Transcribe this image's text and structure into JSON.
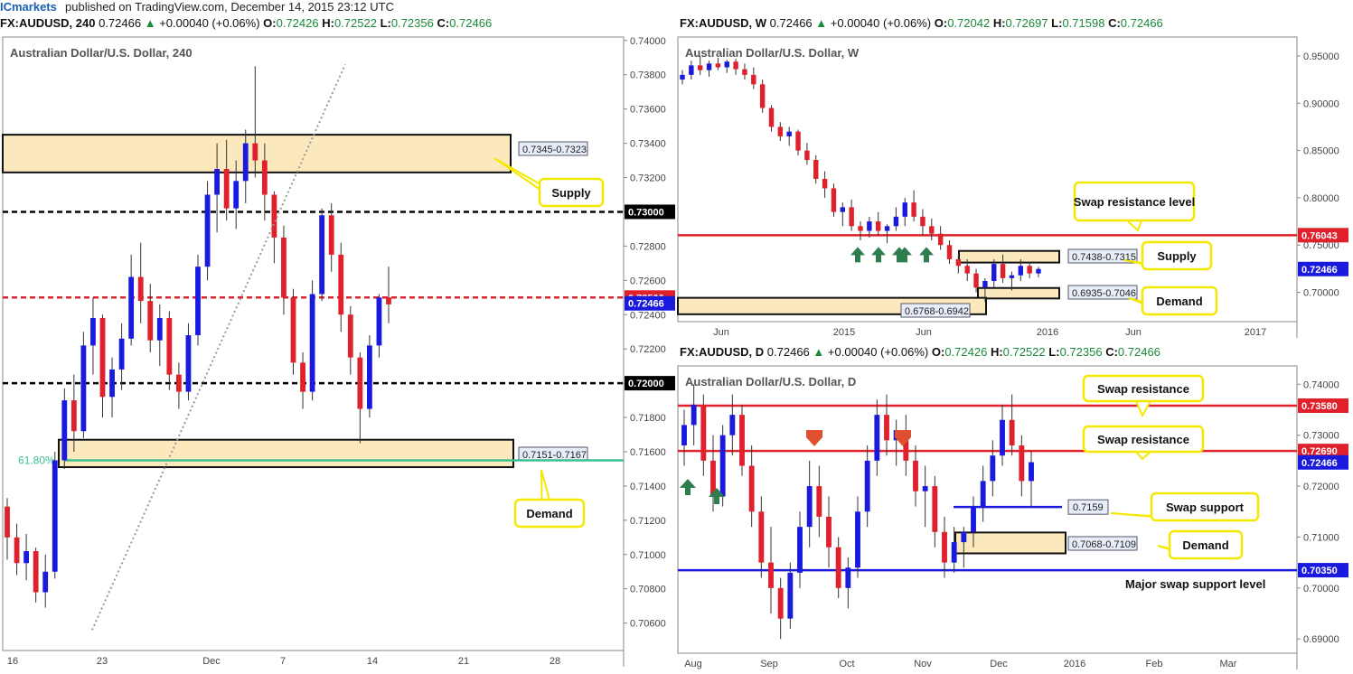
{
  "publisher": {
    "brand": "ICmarkets",
    "text": "published on TradingView.com, December 14, 2015 23:12 UTC"
  },
  "panels": {
    "h4": {
      "header": {
        "symbol": "FX:AUDUSD, 240",
        "price": "0.72466",
        "change": "+0.00040 (+0.06%)",
        "o_label": "O:",
        "o": "0.72426",
        "h_label": "H:",
        "h": "0.72522",
        "l_label": "L:",
        "l": "0.72356",
        "c_label": "C:",
        "c": "0.72466"
      },
      "title": "Australian Dollar/U.S. Dollar, 240"
    },
    "weekly": {
      "header": {
        "symbol": "FX:AUDUSD, W",
        "price": "0.72466",
        "change": "+0.00040 (+0.06%)",
        "o_label": "O:",
        "o": "0.72042",
        "h_label": "H:",
        "h": "0.72697",
        "l_label": "L:",
        "l": "0.71598",
        "c_label": "C:",
        "c": "0.72466"
      },
      "title": "Australian Dollar/U.S. Dollar, W"
    },
    "daily": {
      "header": {
        "symbol": "FX:AUDUSD, D",
        "price": "0.72466",
        "change": "+0.00040 (+0.06%)",
        "o_label": "O:",
        "o": "0.72426",
        "h_label": "H:",
        "h": "0.72522",
        "l_label": "L:",
        "l": "0.72356",
        "c_label": "C:",
        "c": "0.72466"
      },
      "title": "Australian Dollar/U.S. Dollar, D"
    }
  },
  "colors": {
    "up": "#1a1adf",
    "down": "#e0202a",
    "zone": "#fbe9bd",
    "callout_border": "#f5e800",
    "fib": "#3dbf8f",
    "support": "#1a1adf",
    "price_label": "#1a1adf",
    "level_red": "#e0202a"
  },
  "chart_data": [
    {
      "id": "h4",
      "type": "candlestick",
      "title": "Australian Dollar/U.S. Dollar, 240",
      "xlabel": "",
      "ylabel": "",
      "x_ticks": [
        "16",
        "23",
        "Dec",
        "7",
        "14",
        "21",
        "28"
      ],
      "y_ticks": [
        "0.74000",
        "0.73800",
        "0.73600",
        "0.73400",
        "0.73200",
        "0.73000",
        "0.72800",
        "0.72600",
        "0.72500",
        "0.72400",
        "0.72200",
        "0.72000",
        "0.71800",
        "0.71600",
        "0.71400",
        "0.71200",
        "0.71000",
        "0.70800",
        "0.70600"
      ],
      "ylim": [
        0.7044,
        0.7402
      ],
      "levels": [
        {
          "value": 0.73,
          "label": "0.73000",
          "style": "dashed",
          "color": "black"
        },
        {
          "value": 0.725,
          "label": "0.72500",
          "style": "dashed",
          "color": "red"
        },
        {
          "value": 0.72,
          "label": "0.72000",
          "style": "dashed",
          "color": "black"
        },
        {
          "value": 0.7155,
          "label": "61.80%",
          "style": "solid",
          "color": "fib"
        }
      ],
      "current_price": "0.72466",
      "zones": [
        {
          "label": "0.7345-0.7323",
          "low": 0.7323,
          "high": 0.7345,
          "callout": "Supply"
        },
        {
          "label": "0.7151-0.7167",
          "low": 0.7151,
          "high": 0.7167,
          "callout": "Demand"
        }
      ],
      "trend_line": {
        "from": [
          0,
          0.7056
        ],
        "to": [
          0.55,
          0.7386
        ],
        "note": "dotted fib line"
      },
      "series": [
        {
          "values": [
            [
              0.7128,
              0.7133,
              0.7097,
              0.711
            ],
            [
              0.711,
              0.7118,
              0.7088,
              0.7095
            ],
            [
              0.7095,
              0.7112,
              0.7085,
              0.7102
            ],
            [
              0.7102,
              0.7104,
              0.7072,
              0.7078
            ],
            [
              0.7078,
              0.71,
              0.7069,
              0.709
            ],
            [
              0.709,
              0.716,
              0.7086,
              0.7155
            ],
            [
              0.7155,
              0.7197,
              0.715,
              0.719
            ],
            [
              0.719,
              0.7205,
              0.716,
              0.7172
            ],
            [
              0.7172,
              0.723,
              0.7168,
              0.7222
            ],
            [
              0.7222,
              0.725,
              0.7205,
              0.7238
            ],
            [
              0.7238,
              0.724,
              0.718,
              0.7192
            ],
            [
              0.7192,
              0.7215,
              0.718,
              0.7208
            ],
            [
              0.7208,
              0.7235,
              0.7196,
              0.7226
            ],
            [
              0.7226,
              0.7275,
              0.7222,
              0.7262
            ],
            [
              0.7262,
              0.7282,
              0.7235,
              0.7248
            ],
            [
              0.7248,
              0.7258,
              0.7218,
              0.7225
            ],
            [
              0.7225,
              0.7246,
              0.721,
              0.7238
            ],
            [
              0.7238,
              0.7242,
              0.7196,
              0.7205
            ],
            [
              0.7205,
              0.7212,
              0.7185,
              0.7195
            ],
            [
              0.7195,
              0.7235,
              0.719,
              0.7228
            ],
            [
              0.7228,
              0.7275,
              0.7222,
              0.7268
            ],
            [
              0.7268,
              0.7318,
              0.726,
              0.731
            ],
            [
              0.731,
              0.734,
              0.7288,
              0.7325
            ],
            [
              0.7325,
              0.7342,
              0.7295,
              0.7302
            ],
            [
              0.7302,
              0.733,
              0.729,
              0.7318
            ],
            [
              0.7318,
              0.7348,
              0.7305,
              0.734
            ],
            [
              0.734,
              0.7385,
              0.732,
              0.733
            ],
            [
              0.733,
              0.734,
              0.7295,
              0.731
            ],
            [
              0.731,
              0.7312,
              0.727,
              0.7285
            ],
            [
              0.7285,
              0.7292,
              0.724,
              0.725
            ],
            [
              0.725,
              0.7255,
              0.7205,
              0.7212
            ],
            [
              0.7212,
              0.7218,
              0.7185,
              0.7195
            ],
            [
              0.7195,
              0.726,
              0.719,
              0.7252
            ],
            [
              0.7252,
              0.7302,
              0.7248,
              0.7298
            ],
            [
              0.7298,
              0.7305,
              0.7265,
              0.7275
            ],
            [
              0.7275,
              0.7282,
              0.723,
              0.724
            ],
            [
              0.724,
              0.7245,
              0.7205,
              0.7215
            ],
            [
              0.7215,
              0.7218,
              0.7165,
              0.7185
            ],
            [
              0.7185,
              0.7228,
              0.718,
              0.7222
            ],
            [
              0.7222,
              0.7252,
              0.7215,
              0.725
            ],
            [
              0.725,
              0.7268,
              0.7235,
              0.7246
            ]
          ]
        }
      ]
    },
    {
      "id": "weekly",
      "type": "candlestick",
      "title": "Australian Dollar/U.S. Dollar, W",
      "xlabel": "",
      "ylabel": "",
      "x_ticks": [
        "Jun",
        "2015",
        "Jun",
        "2016",
        "Jun",
        "2017"
      ],
      "y_ticks": [
        "0.95000",
        "0.90000",
        "0.85000",
        "0.80000",
        "0.75000",
        "0.70000"
      ],
      "ylim": [
        0.669,
        0.97
      ],
      "levels": [
        {
          "value": 0.76043,
          "label": "0.76043",
          "style": "solid",
          "color": "red",
          "callout": "Swap resistance level"
        }
      ],
      "current_price": "0.72466",
      "zones": [
        {
          "label": "0.7438-0.7315",
          "low": 0.7315,
          "high": 0.7438,
          "callout": "Supply"
        },
        {
          "label": "0.6935-0.7046",
          "low": 0.6935,
          "high": 0.7046,
          "callout": "Demand"
        },
        {
          "label": "0.6768-0.6942",
          "low": 0.6768,
          "high": 0.6942,
          "callout": ""
        }
      ],
      "markers": [
        {
          "type": "up-arrow",
          "count": 5
        }
      ],
      "series": [
        {
          "values": [
            [
              0.925,
              0.935,
              0.92,
              0.93
            ],
            [
              0.93,
              0.945,
              0.925,
              0.94
            ],
            [
              0.94,
              0.95,
              0.93,
              0.935
            ],
            [
              0.935,
              0.945,
              0.928,
              0.942
            ],
            [
              0.942,
              0.948,
              0.935,
              0.938
            ],
            [
              0.938,
              0.946,
              0.932,
              0.944
            ],
            [
              0.944,
              0.947,
              0.93,
              0.936
            ],
            [
              0.936,
              0.942,
              0.925,
              0.93
            ],
            [
              0.93,
              0.938,
              0.915,
              0.92
            ],
            [
              0.92,
              0.925,
              0.89,
              0.895
            ],
            [
              0.895,
              0.898,
              0.87,
              0.875
            ],
            [
              0.875,
              0.88,
              0.86,
              0.865
            ],
            [
              0.865,
              0.875,
              0.855,
              0.87
            ],
            [
              0.87,
              0.872,
              0.845,
              0.85
            ],
            [
              0.85,
              0.858,
              0.835,
              0.84
            ],
            [
              0.84,
              0.845,
              0.815,
              0.82
            ],
            [
              0.82,
              0.828,
              0.8,
              0.81
            ],
            [
              0.81,
              0.815,
              0.78,
              0.785
            ],
            [
              0.785,
              0.795,
              0.77,
              0.79
            ],
            [
              0.79,
              0.798,
              0.765,
              0.77
            ],
            [
              0.77,
              0.775,
              0.755,
              0.765
            ],
            [
              0.765,
              0.78,
              0.758,
              0.775
            ],
            [
              0.775,
              0.785,
              0.76,
              0.765
            ],
            [
              0.765,
              0.772,
              0.752,
              0.77
            ],
            [
              0.77,
              0.79,
              0.765,
              0.78
            ],
            [
              0.78,
              0.8,
              0.77,
              0.795
            ],
            [
              0.795,
              0.808,
              0.775,
              0.78
            ],
            [
              0.78,
              0.788,
              0.76,
              0.77
            ],
            [
              0.77,
              0.778,
              0.755,
              0.762
            ],
            [
              0.762,
              0.77,
              0.745,
              0.75
            ],
            [
              0.75,
              0.755,
              0.73,
              0.735
            ],
            [
              0.735,
              0.74,
              0.72,
              0.728
            ],
            [
              0.728,
              0.735,
              0.712,
              0.72
            ],
            [
              0.72,
              0.725,
              0.7,
              0.705
            ],
            [
              0.705,
              0.715,
              0.69,
              0.712
            ],
            [
              0.712,
              0.735,
              0.705,
              0.73
            ],
            [
              0.73,
              0.74,
              0.71,
              0.715
            ],
            [
              0.715,
              0.722,
              0.702,
              0.718
            ],
            [
              0.718,
              0.735,
              0.712,
              0.728
            ],
            [
              0.728,
              0.732,
              0.715,
              0.72
            ],
            [
              0.72,
              0.727,
              0.716,
              0.7247
            ]
          ]
        }
      ]
    },
    {
      "id": "daily",
      "type": "candlestick",
      "title": "Australian Dollar/U.S. Dollar, D",
      "xlabel": "",
      "ylabel": "",
      "x_ticks": [
        "Aug",
        "Sep",
        "Oct",
        "Nov",
        "Dec",
        "2016",
        "Feb",
        "Mar"
      ],
      "y_ticks": [
        "0.74000",
        "0.73000",
        "0.72000",
        "0.71000",
        "0.70000",
        "0.69000"
      ],
      "ylim": [
        0.6872,
        0.7436
      ],
      "levels": [
        {
          "value": 0.7358,
          "label": "0.73580",
          "style": "solid",
          "color": "red",
          "callout": "Swap resistance"
        },
        {
          "value": 0.7269,
          "label": "0.72690",
          "style": "solid",
          "color": "red",
          "callout": "Swap resistance"
        },
        {
          "value": 0.7159,
          "label": "0.7159",
          "style": "solid",
          "color": "blue",
          "callout": "Swap support"
        },
        {
          "value": 0.7035,
          "label": "0.70350",
          "style": "solid",
          "color": "blue",
          "callout": "Major swap support level"
        }
      ],
      "current_price": "0.72466",
      "zones": [
        {
          "label": "0.7068-0.7109",
          "low": 0.7068,
          "high": 0.7109,
          "callout": "Demand"
        }
      ],
      "markers": [
        {
          "type": "up-arrow",
          "count": 2
        },
        {
          "type": "down-arrow",
          "count": 2
        }
      ],
      "series": [
        {
          "values": [
            [
              0.728,
              0.735,
              0.724,
              0.732
            ],
            [
              0.732,
              0.74,
              0.728,
              0.736
            ],
            [
              0.736,
              0.738,
              0.722,
              0.725
            ],
            [
              0.725,
              0.73,
              0.715,
              0.718
            ],
            [
              0.718,
              0.732,
              0.716,
              0.73
            ],
            [
              0.73,
              0.738,
              0.726,
              0.734
            ],
            [
              0.734,
              0.736,
              0.722,
              0.724
            ],
            [
              0.724,
              0.728,
              0.712,
              0.715
            ],
            [
              0.715,
              0.718,
              0.702,
              0.705
            ],
            [
              0.705,
              0.712,
              0.695,
              0.7
            ],
            [
              0.7,
              0.702,
              0.69,
              0.694
            ],
            [
              0.694,
              0.705,
              0.692,
              0.703
            ],
            [
              0.703,
              0.715,
              0.7,
              0.712
            ],
            [
              0.712,
              0.725,
              0.708,
              0.72
            ],
            [
              0.72,
              0.724,
              0.71,
              0.714
            ],
            [
              0.714,
              0.718,
              0.704,
              0.708
            ],
            [
              0.708,
              0.71,
              0.698,
              0.7
            ],
            [
              0.7,
              0.706,
              0.696,
              0.704
            ],
            [
              0.704,
              0.718,
              0.702,
              0.715
            ],
            [
              0.715,
              0.728,
              0.712,
              0.725
            ],
            [
              0.725,
              0.737,
              0.722,
              0.734
            ],
            [
              0.734,
              0.738,
              0.726,
              0.729
            ],
            [
              0.729,
              0.733,
              0.724,
              0.731
            ],
            [
              0.731,
              0.734,
              0.722,
              0.725
            ],
            [
              0.725,
              0.728,
              0.716,
              0.719
            ],
            [
              0.719,
              0.724,
              0.712,
              0.72
            ],
            [
              0.72,
              0.722,
              0.708,
              0.711
            ],
            [
              0.711,
              0.714,
              0.702,
              0.705
            ],
            [
              0.705,
              0.712,
              0.703,
              0.709
            ],
            [
              0.709,
              0.712,
              0.704,
              0.711
            ],
            [
              0.711,
              0.718,
              0.708,
              0.716
            ],
            [
              0.716,
              0.724,
              0.713,
              0.721
            ],
            [
              0.721,
              0.729,
              0.718,
              0.726
            ],
            [
              0.726,
              0.736,
              0.724,
              0.733
            ],
            [
              0.733,
              0.738,
              0.726,
              0.728
            ],
            [
              0.728,
              0.73,
              0.718,
              0.721
            ],
            [
              0.721,
              0.727,
              0.716,
              0.7247
            ]
          ]
        }
      ]
    }
  ]
}
